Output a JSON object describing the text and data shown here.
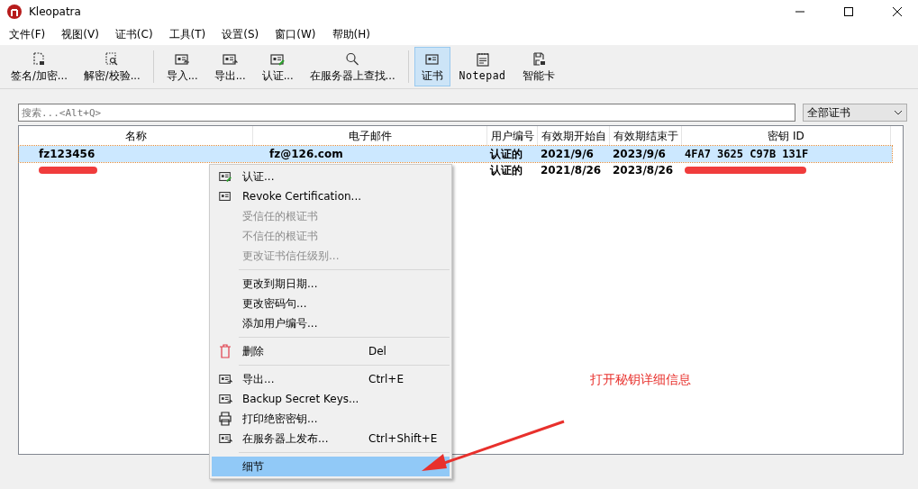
{
  "window": {
    "title": "Kleopatra"
  },
  "menu_bar": [
    "文件(F)",
    "视图(V)",
    "证书(C)",
    "工具(T)",
    "设置(S)",
    "窗口(W)",
    "帮助(H)"
  ],
  "toolbar": [
    {
      "kind": "button",
      "label": "签名/加密...",
      "selected": false
    },
    {
      "kind": "button",
      "label": "解密/校验...",
      "selected": false
    },
    {
      "kind": "separator"
    },
    {
      "kind": "button",
      "label": "导入...",
      "selected": false
    },
    {
      "kind": "button",
      "label": "导出...",
      "selected": false
    },
    {
      "kind": "button",
      "label": "认证...",
      "selected": false
    },
    {
      "kind": "button",
      "label": "在服务器上查找...",
      "selected": false
    },
    {
      "kind": "separator"
    },
    {
      "kind": "button",
      "label": "证书",
      "selected": true
    },
    {
      "kind": "button",
      "label": "Notepad",
      "selected": false
    },
    {
      "kind": "button",
      "label": "智能卡",
      "selected": false
    }
  ],
  "search": {
    "placeholder": "搜索...<Alt+Q>"
  },
  "filter": {
    "value": "全部证书"
  },
  "table": {
    "columns": [
      "名称",
      "电子邮件",
      "用户编号",
      "有效期开始自",
      "有效期结束于",
      "密钥 ID"
    ],
    "rows": [
      {
        "selected": true,
        "cells": [
          {
            "text": "fz123456",
            "redacted": false
          },
          {
            "text": "fz@126.com",
            "redacted": false
          },
          {
            "text": "认证的",
            "redacted": false
          },
          {
            "text": "2021/9/6",
            "redacted": false
          },
          {
            "text": "2023/9/6",
            "redacted": false
          },
          {
            "text": "4FA7 3625 C97B 131F",
            "redacted": false
          }
        ]
      },
      {
        "selected": false,
        "cells": [
          {
            "redacted": true
          },
          null,
          {
            "text": "认证的",
            "redacted": false
          },
          {
            "text": "2021/8/26",
            "redacted": false
          },
          {
            "text": "2023/8/26",
            "redacted": false
          },
          {
            "redacted": true
          }
        ]
      }
    ]
  },
  "context_menu": [
    {
      "kind": "item",
      "label": "认证...",
      "disabled": false,
      "selected": false
    },
    {
      "kind": "item",
      "label": "Revoke Certification...",
      "disabled": false,
      "selected": false
    },
    {
      "kind": "item",
      "label": "受信任的根证书",
      "disabled": true,
      "selected": false
    },
    {
      "kind": "item",
      "label": "不信任的根证书",
      "disabled": true,
      "selected": false
    },
    {
      "kind": "item",
      "label": "更改证书信任级别...",
      "disabled": true,
      "selected": false
    },
    {
      "kind": "separator"
    },
    {
      "kind": "item",
      "label": "更改到期日期...",
      "disabled": false,
      "selected": false
    },
    {
      "kind": "item",
      "label": "更改密码句...",
      "disabled": false,
      "selected": false
    },
    {
      "kind": "item",
      "label": "添加用户编号...",
      "disabled": false,
      "selected": false
    },
    {
      "kind": "separator"
    },
    {
      "kind": "item",
      "label": "删除",
      "shortcut": "Del",
      "disabled": false,
      "selected": false
    },
    {
      "kind": "separator"
    },
    {
      "kind": "item",
      "label": "导出...",
      "shortcut": "Ctrl+E",
      "disabled": false,
      "selected": false
    },
    {
      "kind": "item",
      "label": "Backup Secret Keys...",
      "disabled": false,
      "selected": false
    },
    {
      "kind": "item",
      "label": "打印绝密密钥...",
      "disabled": false,
      "selected": false
    },
    {
      "kind": "item",
      "label": "在服务器上发布...",
      "shortcut": "Ctrl+Shift+E",
      "disabled": false,
      "selected": false
    },
    {
      "kind": "separator"
    },
    {
      "kind": "item",
      "label": "细节",
      "disabled": false,
      "selected": true
    }
  ],
  "annotation": {
    "text": "打开秘钥详细信息"
  }
}
